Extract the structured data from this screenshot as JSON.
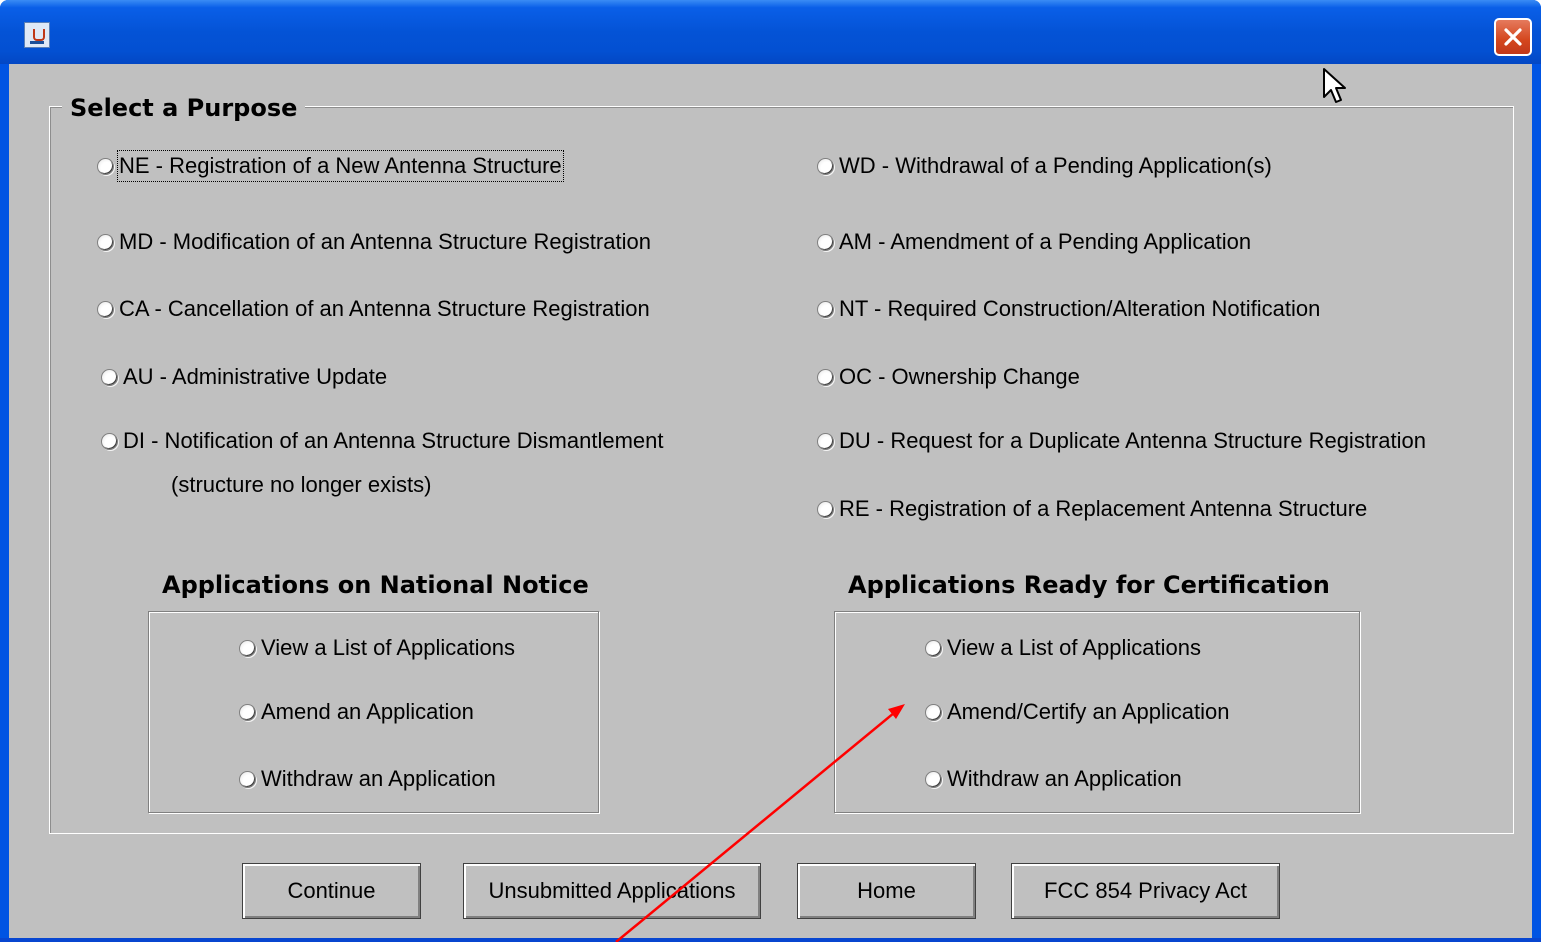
{
  "window": {
    "title": ""
  },
  "purpose_group": {
    "legend": "Select a Purpose",
    "left_options": [
      {
        "label": "NE - Registration of a New Antenna Structure",
        "checked": false,
        "focused": true
      },
      {
        "label": "MD - Modification of an Antenna Structure Registration",
        "checked": false
      },
      {
        "label": "CA - Cancellation of an Antenna Structure Registration",
        "checked": false
      },
      {
        "label": "AU - Administrative Update",
        "checked": false
      },
      {
        "label": "DI - Notification of an Antenna Structure Dismantlement",
        "sublabel": "(structure no longer exists)",
        "checked": false
      }
    ],
    "right_options": [
      {
        "label": "WD - Withdrawal of a Pending Application(s)",
        "checked": false
      },
      {
        "label": "AM - Amendment of a Pending Application",
        "checked": false
      },
      {
        "label": "NT - Required Construction/Alteration Notification",
        "checked": false
      },
      {
        "label": "OC - Ownership Change",
        "checked": false
      },
      {
        "label": "DU - Request for a Duplicate Antenna Structure Registration",
        "checked": false
      },
      {
        "label": "RE - Registration of a Replacement Antenna Structure",
        "checked": false
      }
    ]
  },
  "national_notice": {
    "title": "Applications on National Notice",
    "options": [
      {
        "label": "View a List of Applications"
      },
      {
        "label": "Amend an Application"
      },
      {
        "label": "Withdraw an Application"
      }
    ]
  },
  "ready_certification": {
    "title": "Applications Ready for Certification",
    "options": [
      {
        "label": "View a List of Applications"
      },
      {
        "label": "Amend/Certify an Application"
      },
      {
        "label": "Withdraw an Application"
      }
    ]
  },
  "buttons": {
    "continue": "Continue",
    "unsubmitted": "Unsubmitted Applications",
    "home": "Home",
    "privacy": "FCC 854 Privacy Act"
  },
  "colors": {
    "titlebar": "#0453d6",
    "client_bg": "#c0c0c0",
    "annotation_arrow": "#ff0000"
  },
  "icons": {
    "app": "java-cup-icon",
    "close": "close-icon",
    "cursor": "mouse-pointer-icon"
  }
}
